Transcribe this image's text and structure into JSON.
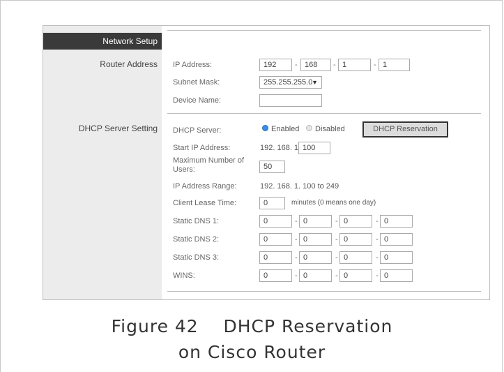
{
  "sidebar": {
    "header": "Network Setup",
    "router_address": "Router Address",
    "dhcp_server_setting": "DHCP Server Setting"
  },
  "router": {
    "ip_label": "IP Address:",
    "ip": [
      "192",
      "168",
      "1",
      "1"
    ],
    "subnet_label": "Subnet Mask:",
    "subnet_value": "255.255.255.0",
    "device_label": "Device Name:",
    "device_value": ""
  },
  "dhcp": {
    "server_label": "DHCP Server:",
    "enabled_label": "Enabled",
    "disabled_label": "Disabled",
    "selected": "Enabled",
    "reservation_button": "DHCP Reservation",
    "start_label": "Start IP Address:",
    "start_prefix": "192. 168. 1.",
    "start_value": "100",
    "max_users_label": "Maximum Number of Users:",
    "max_users_value": "50",
    "range_label": "IP Address Range:",
    "range_value": "192. 168. 1. 100 to 249",
    "lease_label": "Client Lease Time:",
    "lease_value": "0",
    "lease_note": "minutes (0 means one day)",
    "dns1_label": "Static DNS 1:",
    "dns1": [
      "0",
      "0",
      "0",
      "0"
    ],
    "dns2_label": "Static DNS 2:",
    "dns2": [
      "0",
      "0",
      "0",
      "0"
    ],
    "dns3_label": "Static DNS 3:",
    "dns3": [
      "0",
      "0",
      "0",
      "0"
    ],
    "wins_label": "WINS:",
    "wins": [
      "0",
      "0",
      "0",
      "0"
    ]
  },
  "caption": {
    "line1": "Figure 42    DHCP Reservation",
    "line2": "on Cisco Router"
  },
  "colors": {
    "header_bg": "#3a3a3a",
    "sidebar_bg": "#ececec",
    "radio_on": "#3a8ee6"
  }
}
